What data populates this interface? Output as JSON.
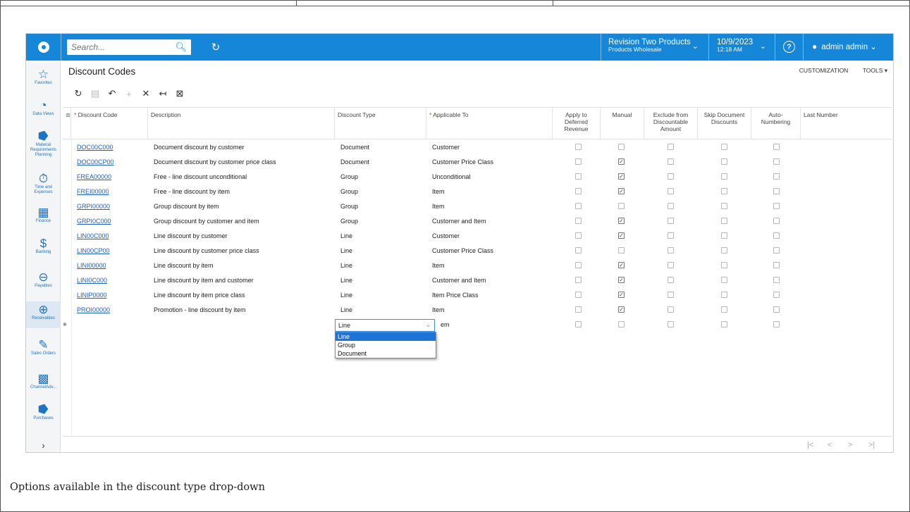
{
  "topbar": {
    "search_placeholder": "Search...",
    "branch_name": "Revision Two Products",
    "branch_sub": "Products Wholesale",
    "date": "10/9/2023",
    "time": "12:18 AM",
    "user": "admin admin"
  },
  "nav": [
    {
      "label": "Favorites",
      "icon": "star-icon"
    },
    {
      "label": "Data Views",
      "icon": "pie-chart-icon"
    },
    {
      "label": "Material Requirements Planning",
      "icon": "cart-icon"
    },
    {
      "label": "Time and Expenses",
      "icon": "stopwatch-icon"
    },
    {
      "label": "Finance",
      "icon": "calculator-icon"
    },
    {
      "label": "Banking",
      "icon": "dollar-icon"
    },
    {
      "label": "Payables",
      "icon": "minus-circle-icon"
    },
    {
      "label": "Receivables",
      "icon": "plus-circle-icon"
    },
    {
      "label": "Sales Orders",
      "icon": "pencil-icon"
    },
    {
      "label": "ChannelAdv...",
      "icon": "building-icon"
    },
    {
      "label": "Purchases",
      "icon": "cart-icon"
    }
  ],
  "page": {
    "title": "Discount Codes",
    "customization": "CUSTOMIZATION",
    "tools": "TOOLS ▾"
  },
  "columns": {
    "discount_code": "Discount Code",
    "description": "Description",
    "discount_type": "Discount Type",
    "applicable_to": "Applicable To",
    "deferred": "Apply to Deferred Revenue",
    "manual": "Manual",
    "exclude": "Exclude from Discountable Amount",
    "skip": "Skip Document Discounts",
    "auto": "Auto-Numbering",
    "last": "Last Number"
  },
  "rows": [
    {
      "code": "DOC00C000",
      "desc": "Document discount by customer",
      "type": "Document",
      "applies": "Customer",
      "manual": false
    },
    {
      "code": "DOC00CP00",
      "desc": "Document discount by customer price class",
      "type": "Document",
      "applies": "Customer Price Class",
      "manual": true
    },
    {
      "code": "FREA00000",
      "desc": "Free - line discount unconditional",
      "type": "Group",
      "applies": "Unconditional",
      "manual": true
    },
    {
      "code": "FREI00000",
      "desc": "Free - line discount by item",
      "type": "Group",
      "applies": "Item",
      "manual": true
    },
    {
      "code": "GRPI00000",
      "desc": "Group discount by item",
      "type": "Group",
      "applies": "Item",
      "manual": false
    },
    {
      "code": "GRPI0C000",
      "desc": "Group discount by customer and item",
      "type": "Group",
      "applies": "Customer and Item",
      "manual": true
    },
    {
      "code": "LIN00C000",
      "desc": "Line discount by customer",
      "type": "Line",
      "applies": "Customer",
      "manual": true
    },
    {
      "code": "LIN00CP00",
      "desc": "Line discount by customer price class",
      "type": "Line",
      "applies": "Customer Price Class",
      "manual": false
    },
    {
      "code": "LINI00000",
      "desc": "Line discount by item",
      "type": "Line",
      "applies": "Item",
      "manual": true
    },
    {
      "code": "LINI0C000",
      "desc": "Line discount by item and customer",
      "type": "Line",
      "applies": "Customer and Item",
      "manual": true
    },
    {
      "code": "LINIP0000",
      "desc": "Line discount by item price class",
      "type": "Line",
      "applies": "Item Price Class",
      "manual": true
    },
    {
      "code": "PROI00000",
      "desc": "Promotion - line discount by item",
      "type": "Line",
      "applies": "Item",
      "manual": true
    }
  ],
  "new_row": {
    "type_value": "Line",
    "applies_partial": "em",
    "options": [
      "Line",
      "Group",
      "Document"
    ]
  },
  "caption": "Options available in the discount type drop-down"
}
